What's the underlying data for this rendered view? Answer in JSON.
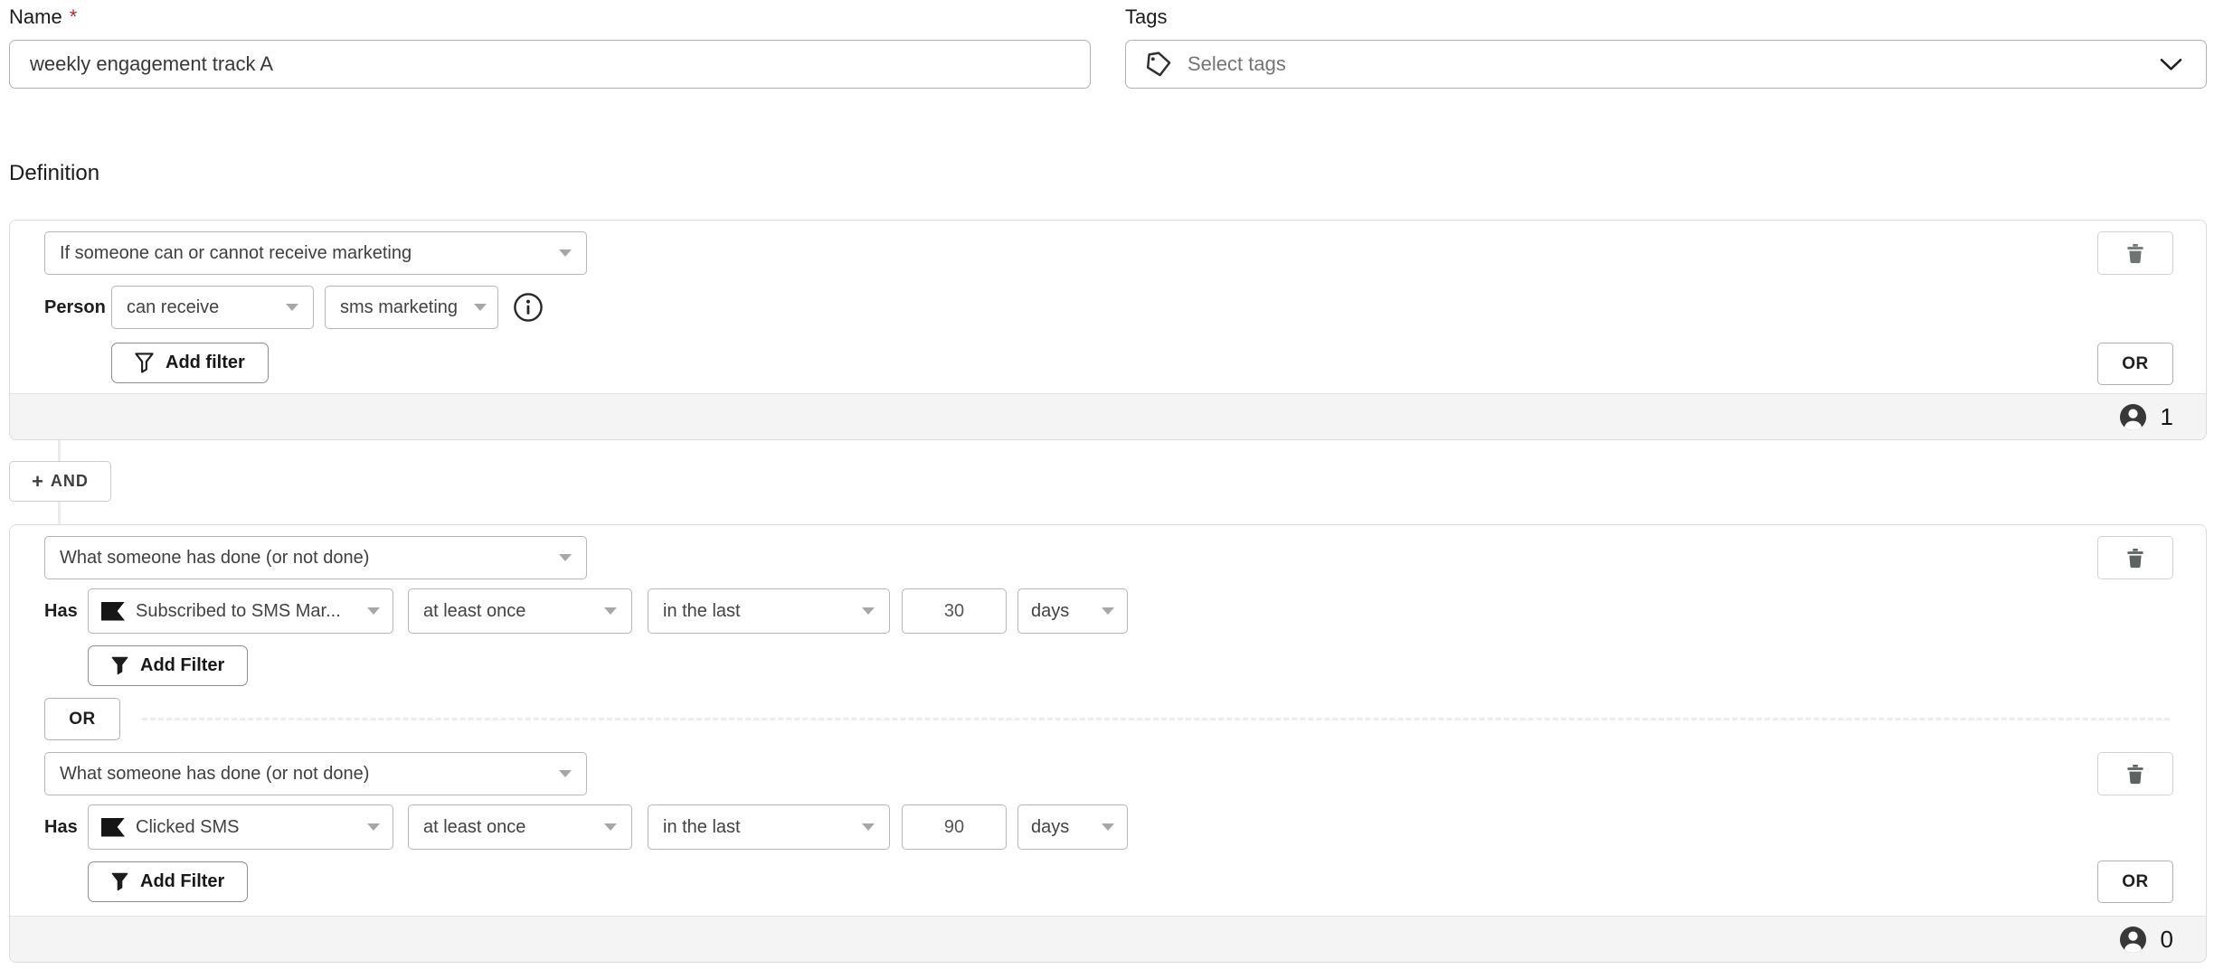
{
  "header": {
    "name_label": "Name",
    "required_mark": "*",
    "name_value": "weekly engagement track A",
    "tags_label": "Tags",
    "tags_placeholder": "Select tags"
  },
  "definition": {
    "heading": "Definition",
    "and_plus": "+",
    "and_label": "AND",
    "consent_card": {
      "condition_type": "If someone can or cannot receive marketing",
      "row_label": "Person",
      "verb": "can receive",
      "channel": "sms marketing",
      "add_filter_label": "Add filter",
      "or_label": "OR",
      "profile_count": "1"
    },
    "activity_card": {
      "or_divider_label": "OR",
      "or_label": "OR",
      "profile_count": "0",
      "blocks": [
        {
          "condition_type": "What someone has done (or not done)",
          "row_label": "Has",
          "metric": "Subscribed to SMS Mar...",
          "frequency": "at least once",
          "window": "in the last",
          "amount": "30",
          "unit": "days",
          "add_filter_label": "Add Filter"
        },
        {
          "condition_type": "What someone has done (or not done)",
          "row_label": "Has",
          "metric": "Clicked SMS",
          "frequency": "at least once",
          "window": "in the last",
          "amount": "90",
          "unit": "days",
          "add_filter_label": "Add Filter"
        }
      ]
    }
  },
  "colors": {
    "required_mark": "#b3282d",
    "footer_bg": "#f4f4f4",
    "card_border": "#dcdcdc",
    "control_border": "#b6b6b6",
    "metric_icon": "#161616"
  }
}
